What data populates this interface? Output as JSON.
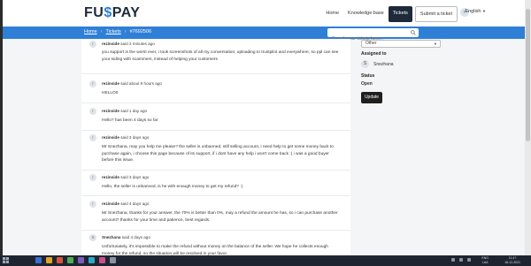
{
  "app": {
    "logo_left": "FU",
    "logo_mid": "$",
    "logo_right": "PAY"
  },
  "nav": {
    "items": [
      {
        "label": "Home"
      },
      {
        "label": "Knowledge base"
      },
      {
        "label": "Tickets"
      },
      {
        "label": "Submit a ticket"
      }
    ],
    "user_initial": "r",
    "language": "English"
  },
  "breadcrumb": {
    "home": "Home",
    "tickets": "Tickets",
    "current": "#7692506"
  },
  "search": {
    "placeholder": "Search your tickets here..."
  },
  "comments": [
    {
      "initial": "r",
      "author": "rezinside",
      "time": "said 2 minutes ago",
      "body": "you support is the worst ever, i took screenshots of all my conversation, uploading to trustpilot and everywhere, so ppl can see your siding with scammers, instead of helping your customers"
    },
    {
      "initial": "r",
      "author": "rezinside",
      "time": "said about 9 hours ago",
      "body": "HELLO0"
    },
    {
      "initial": "r",
      "author": "rezinside",
      "time": "said 1 day ago",
      "body": "Hello? has been 4 days so far"
    },
    {
      "initial": "r",
      "author": "rezinside",
      "time": "said 3 days ago",
      "body": "Mr Snezhana, may you help me please? the seller is unbanned, still selling account, i need help to get some money back to purchase again, i choose this page because of its support, if i dont have any help i won't come back :( i was a good buyer before this issue."
    },
    {
      "initial": "r",
      "author": "rezinside",
      "time": "said 3 days ago",
      "body": "Hello, the seller is unbanned, is he with enough money to get my refund? :)"
    },
    {
      "initial": "r",
      "author": "rezinside",
      "time": "said 4 days ago",
      "body": "Mr Snezhana, thanks for your answer, the 70% is better than 0%, may a refund the amount he has, so i can purchase another account? thanks for your time and patience, best regards."
    },
    {
      "initial": "S",
      "author": "Snezhana",
      "time": "said 4 days ago",
      "body": "Unfortunately, it's impossible to make the refund without money on the balance of the seller. We hope he collects enough money for the refund, so the situation will be resolved in your favor."
    }
  ],
  "sidebar": {
    "status_select": "Other",
    "assigned_label": "Assigned to",
    "assignee_initial": "S",
    "assignee_name": "Snezhana",
    "status_label": "Status",
    "status_value": "Open",
    "update_label": "Update"
  },
  "taskbar": {
    "lang_line1": "ENG",
    "lang_line2": "LAA",
    "time": "11:47",
    "date": "18-12-2021"
  },
  "colors": {
    "brand_blue": "#2f7fd6",
    "navbar_dark": "#1e2a3a"
  }
}
